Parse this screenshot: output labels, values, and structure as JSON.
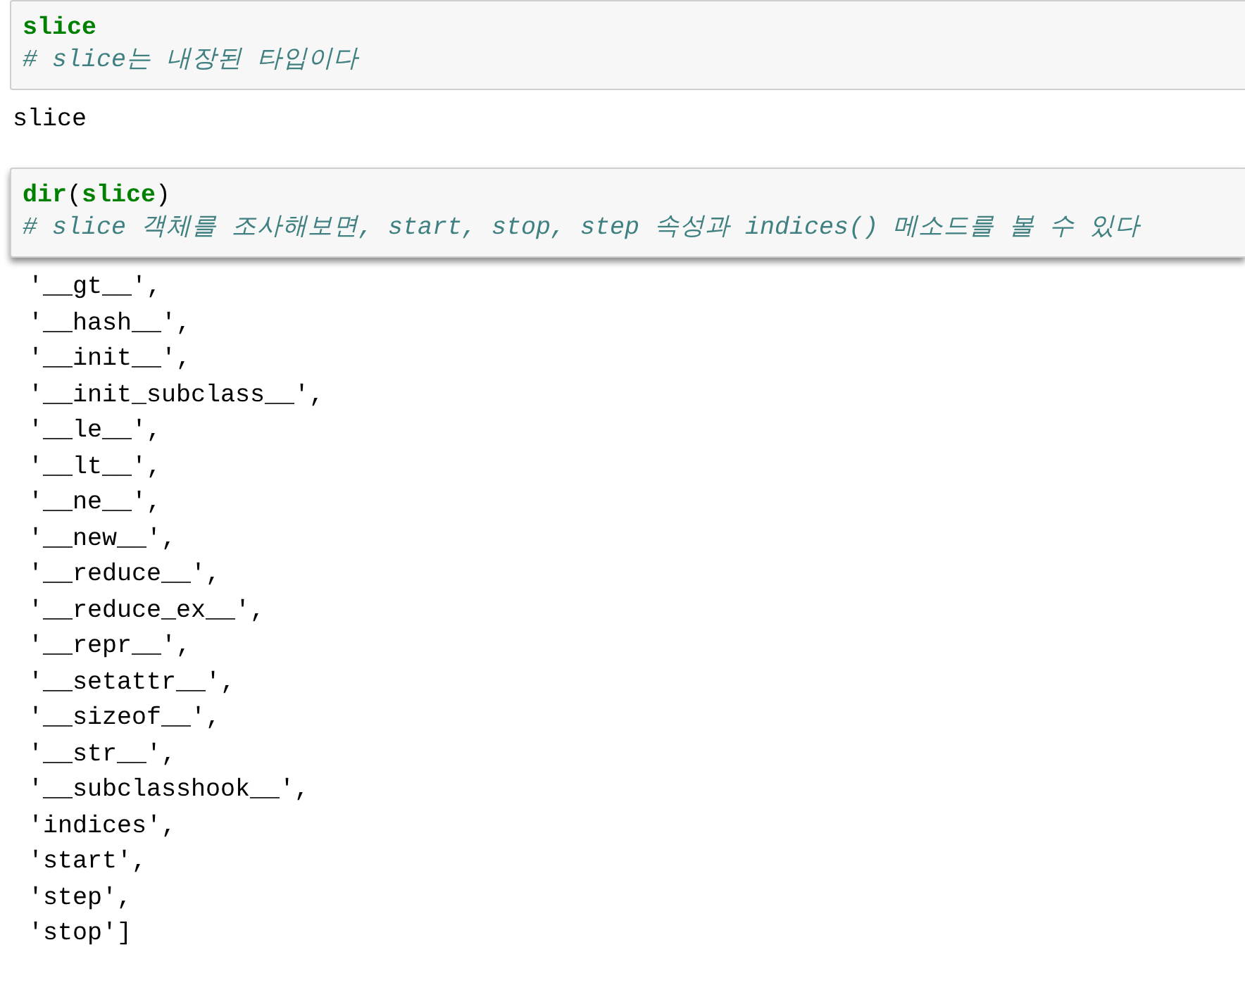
{
  "cells": [
    {
      "input": [
        [
          {
            "kind": "builtin",
            "text": "slice"
          }
        ],
        [
          {
            "kind": "comment",
            "text": "# slice는 내장된 타입이다"
          }
        ]
      ],
      "output": [
        "slice"
      ]
    },
    {
      "input": [
        [
          {
            "kind": "builtin",
            "text": "dir"
          },
          {
            "kind": "plain",
            "text": "("
          },
          {
            "kind": "builtin",
            "text": "slice"
          },
          {
            "kind": "plain",
            "text": ")"
          }
        ],
        [
          {
            "kind": "comment",
            "text": "# slice 객체를 조사해보면, start, stop, step 속성과 indices() 메소드를 볼 수 있다"
          }
        ]
      ],
      "output": [
        "'__gt__',",
        "'__hash__',",
        "'__init__',",
        "'__init_subclass__',",
        "'__le__',",
        "'__lt__',",
        "'__ne__',",
        "'__new__',",
        "'__reduce__',",
        "'__reduce_ex__',",
        "'__repr__',",
        "'__setattr__',",
        "'__sizeof__',",
        "'__str__',",
        "'__subclasshook__',",
        "'indices',",
        "'start',",
        "'step',",
        "'stop']"
      ]
    }
  ]
}
